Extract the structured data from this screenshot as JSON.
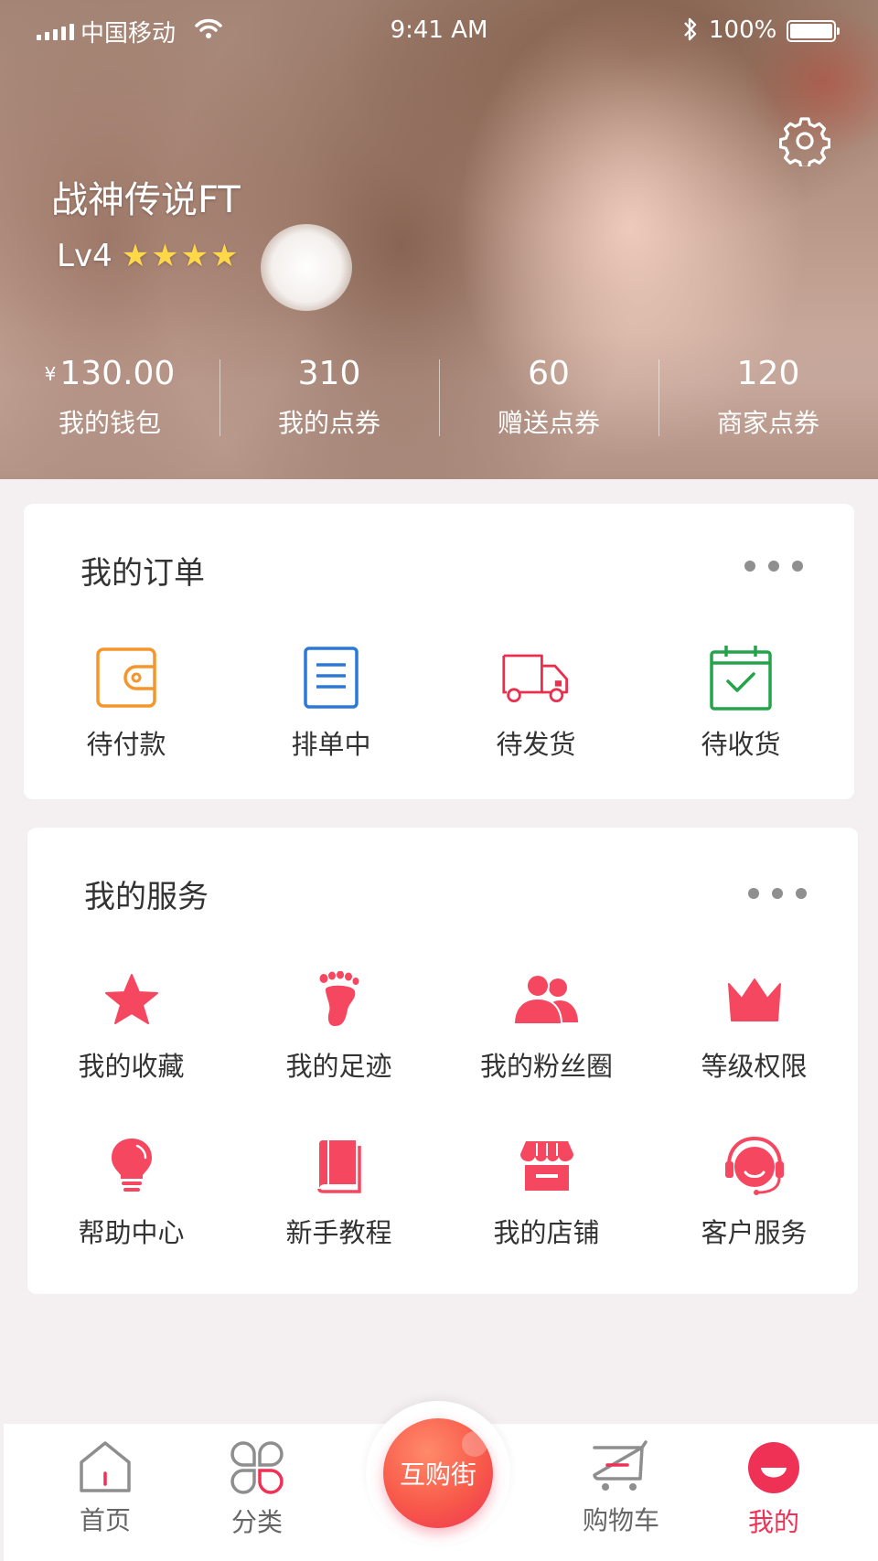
{
  "status_bar": {
    "carrier": "中国移动",
    "time": "9:41 AM",
    "battery": "100%"
  },
  "profile": {
    "username": "战神传说FT",
    "level": "Lv4",
    "stars": [
      "★",
      "★",
      "★",
      "★"
    ]
  },
  "stats": [
    {
      "currency": "¥",
      "value": "130.00",
      "label": "我的钱包"
    },
    {
      "value": "310",
      "label": "我的点券"
    },
    {
      "value": "60",
      "label": "赠送点券"
    },
    {
      "value": "120",
      "label": "商家点券"
    }
  ],
  "orders": {
    "title": "我的订单",
    "items": [
      {
        "label": "待付款",
        "icon": "wallet-icon",
        "color": "#f5962d"
      },
      {
        "label": "排单中",
        "icon": "list-icon",
        "color": "#2b78d6"
      },
      {
        "label": "待发货",
        "icon": "truck-icon",
        "color": "#ea2f4e"
      },
      {
        "label": "待收货",
        "icon": "calendar-check-icon",
        "color": "#23a44a"
      }
    ]
  },
  "services": {
    "title": "我的服务",
    "items": [
      {
        "label": "我的收藏",
        "icon": "star-icon"
      },
      {
        "label": "我的足迹",
        "icon": "footprint-icon"
      },
      {
        "label": "我的粉丝圈",
        "icon": "users-icon"
      },
      {
        "label": "等级权限",
        "icon": "crown-icon"
      },
      {
        "label": "帮助中心",
        "icon": "lightbulb-icon"
      },
      {
        "label": "新手教程",
        "icon": "book-icon"
      },
      {
        "label": "我的店铺",
        "icon": "shop-icon"
      },
      {
        "label": "客户服务",
        "icon": "headset-icon"
      }
    ],
    "icon_color": "#f5475f"
  },
  "tabbar": {
    "home": "首页",
    "category": "分类",
    "center": "互购街",
    "cart": "购物车",
    "mine": "我的",
    "active": "mine",
    "active_color": "#ee3155"
  }
}
